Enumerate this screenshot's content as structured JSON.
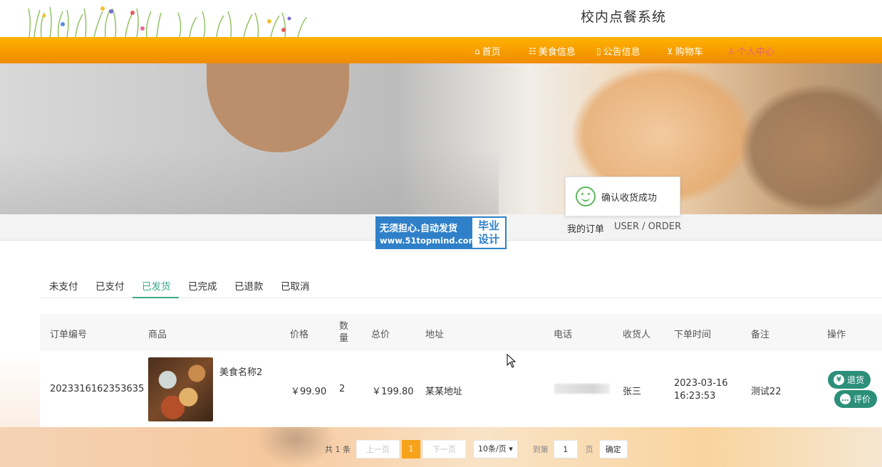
{
  "header": {
    "site_title": "校内点餐系统"
  },
  "nav": {
    "items": [
      {
        "icon": "home-icon",
        "label": "首页",
        "active": false
      },
      {
        "icon": "food-icon",
        "label": "美食信息",
        "active": false
      },
      {
        "icon": "notice-icon",
        "label": "公告信息",
        "active": false
      },
      {
        "icon": "cart-icon",
        "label": "购物车",
        "active": false
      },
      {
        "icon": "user-icon",
        "label": "个人中心",
        "active": true
      }
    ]
  },
  "page": {
    "title": "我的订单",
    "subtitle": "USER / ORDER"
  },
  "watermark": {
    "line1": "无须担心.自动发货",
    "line2": "www.51topmind.com",
    "badge1": "毕业",
    "badge2": "设计"
  },
  "toast": {
    "message": "确认收货成功"
  },
  "tabs": [
    "未支付",
    "已支付",
    "已发货",
    "已完成",
    "已退款",
    "已取消"
  ],
  "active_tab": "已发货",
  "table": {
    "headers": {
      "order_no": "订单编号",
      "product": "商品",
      "price": "价格",
      "qty_1": "数",
      "qty_2": "量",
      "total": "总价",
      "address": "地址",
      "phone": "电话",
      "receiver": "收货人",
      "order_time": "下单时间",
      "remark": "备注",
      "action": "操作"
    },
    "row": {
      "order_no": "2023316162353635",
      "product_name": "美食名称2",
      "price": "￥99.90",
      "qty": "2",
      "total": "￥199.80",
      "address": "某某地址",
      "phone": "",
      "receiver": "张三",
      "order_date": "2023-03-16",
      "order_clock": "16:23:53",
      "remark": "测试22",
      "refund_label": "退货",
      "review_label": "评价"
    }
  },
  "pager": {
    "total": "共 1 条",
    "prev": "上一页",
    "current": "1",
    "next": "下一页",
    "page_size": "10条/页",
    "goto": "到第",
    "goto_value": "1",
    "unit": "页",
    "confirm": "确定"
  },
  "colors": {
    "nav": "#f59a00",
    "accent": "#3aaa8a",
    "active_nav": "#e8607a",
    "pager_current": "#f7a21b"
  }
}
